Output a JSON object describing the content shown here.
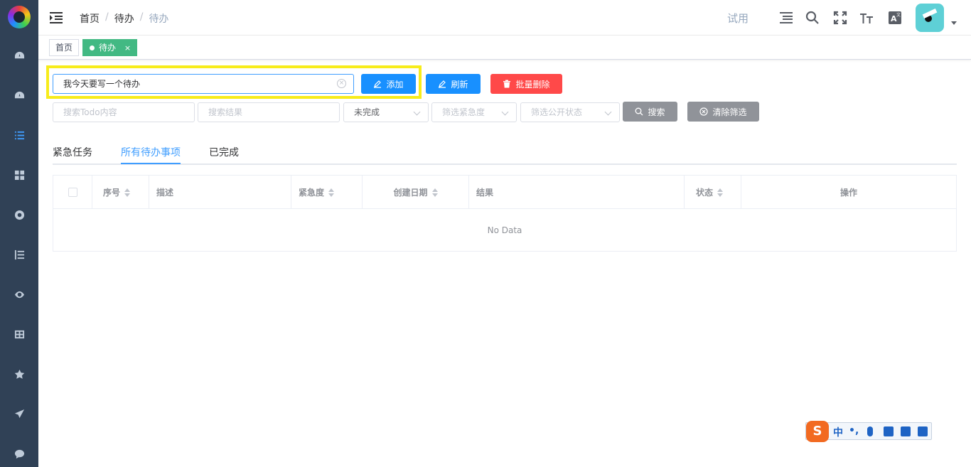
{
  "breadcrumb": [
    "首页",
    "待办",
    "待办"
  ],
  "header": {
    "trial": "试用"
  },
  "tags": [
    {
      "label": "首页"
    },
    {
      "label": "待办",
      "close": "×"
    }
  ],
  "add_form": {
    "input_value": "我今天要写一个待办",
    "add_label": "添加",
    "refresh_label": "刷新",
    "batch_delete_label": "批量删除"
  },
  "filters": {
    "todo_placeholder": "搜索Todo内容",
    "result_placeholder": "搜索结果",
    "status_value": "未完成",
    "urgency_placeholder": "筛选紧急度",
    "public_placeholder": "筛选公开状态",
    "search_label": "搜索",
    "clear_label": "清除筛选"
  },
  "tabs": [
    "紧急任务",
    "所有待办事项",
    "已完成"
  ],
  "table": {
    "columns": [
      "序号",
      "描述",
      "紧急度",
      "创建日期",
      "结果",
      "状态",
      "操作"
    ],
    "empty": "No Data"
  },
  "ime": {
    "mode": "中",
    "punct": "•,",
    "logo": "S"
  },
  "colors": {
    "primary": "#1890ff",
    "danger": "#ff4949",
    "tag_active": "#42b983",
    "sidebar": "#304156",
    "highlight": "#f7ec1a"
  }
}
